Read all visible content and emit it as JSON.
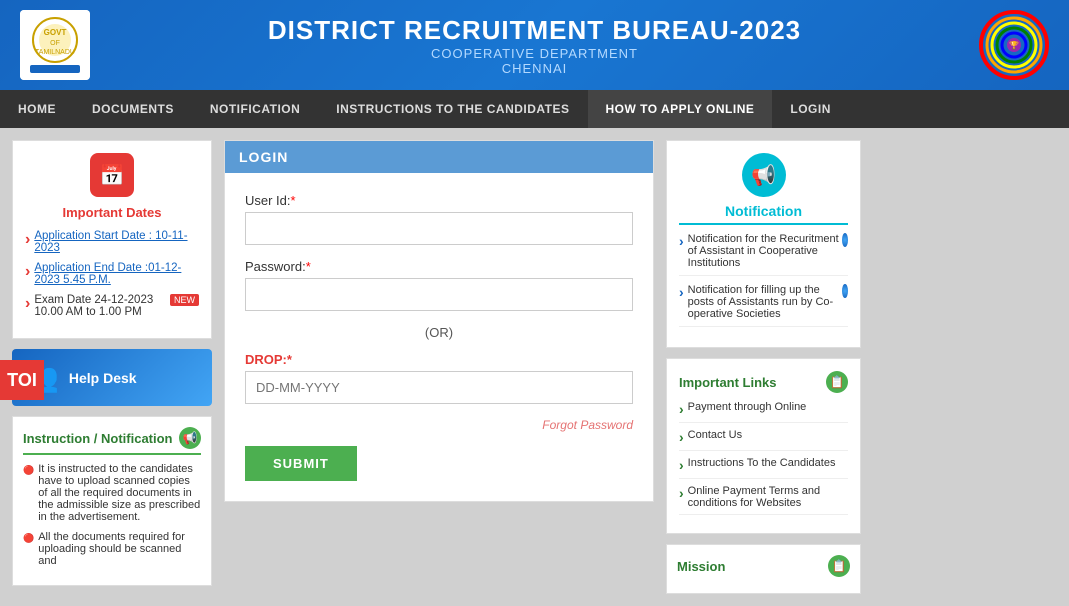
{
  "header": {
    "title": "DISTRICT RECRUITMENT BUREAU-2023",
    "subtitle1": "COOPERATIVE DEPARTMENT",
    "subtitle2": "CHENNAI"
  },
  "navbar": {
    "items": [
      {
        "label": "HOME",
        "active": false
      },
      {
        "label": "DOCUMENTS",
        "active": false
      },
      {
        "label": "NOTIFICATION",
        "active": false
      },
      {
        "label": "INSTRUCTIONS TO THE CANDIDATES",
        "active": false
      },
      {
        "label": "HOW TO APPLY ONLINE",
        "active": true
      },
      {
        "label": "LOGIN",
        "active": false
      }
    ]
  },
  "sidebar_left": {
    "important_dates_title": "Important Dates",
    "dates": [
      "Application Start Date : 10-11-2023",
      "Application End Date :01-12-2023 5.45 P.M.",
      "Exam Date 24-12-2023 10.00 AM to 1.00 PM"
    ],
    "new_badge": "NEW",
    "helpdesk_label": "Help Desk",
    "instruction_title": "Instruction / Notification",
    "instructions": [
      "It is instructed to the candidates have to upload scanned copies of all the required documents in the admissible size as prescribed in the advertisement.",
      "All the documents required for uploading should be scanned and"
    ]
  },
  "login": {
    "header": "LOGIN",
    "user_id_label": "User Id:",
    "user_id_required": "*",
    "password_label": "Password:",
    "password_required": "*",
    "or_label": "(OR)",
    "drop_label": "DROP:",
    "drop_required": "*",
    "drop_placeholder": "DD-MM-YYYY",
    "forgot_password": "Forgot Password",
    "submit_label": "SUBMIT"
  },
  "sidebar_right": {
    "notification_title": "Notification",
    "notifications": [
      "Notification for the Recuritment of Assistant in Cooperative Institutions",
      "Notification for filling up the posts of Assistants run by Co-operative Societies"
    ],
    "important_links_title": "Important Links",
    "links": [
      "Payment through Online",
      "Contact Us",
      "Instructions To the Candidates",
      "Online Payment Terms and conditions for Websites"
    ],
    "mission_title": "Mission"
  },
  "toi": {
    "label": "TOI"
  }
}
